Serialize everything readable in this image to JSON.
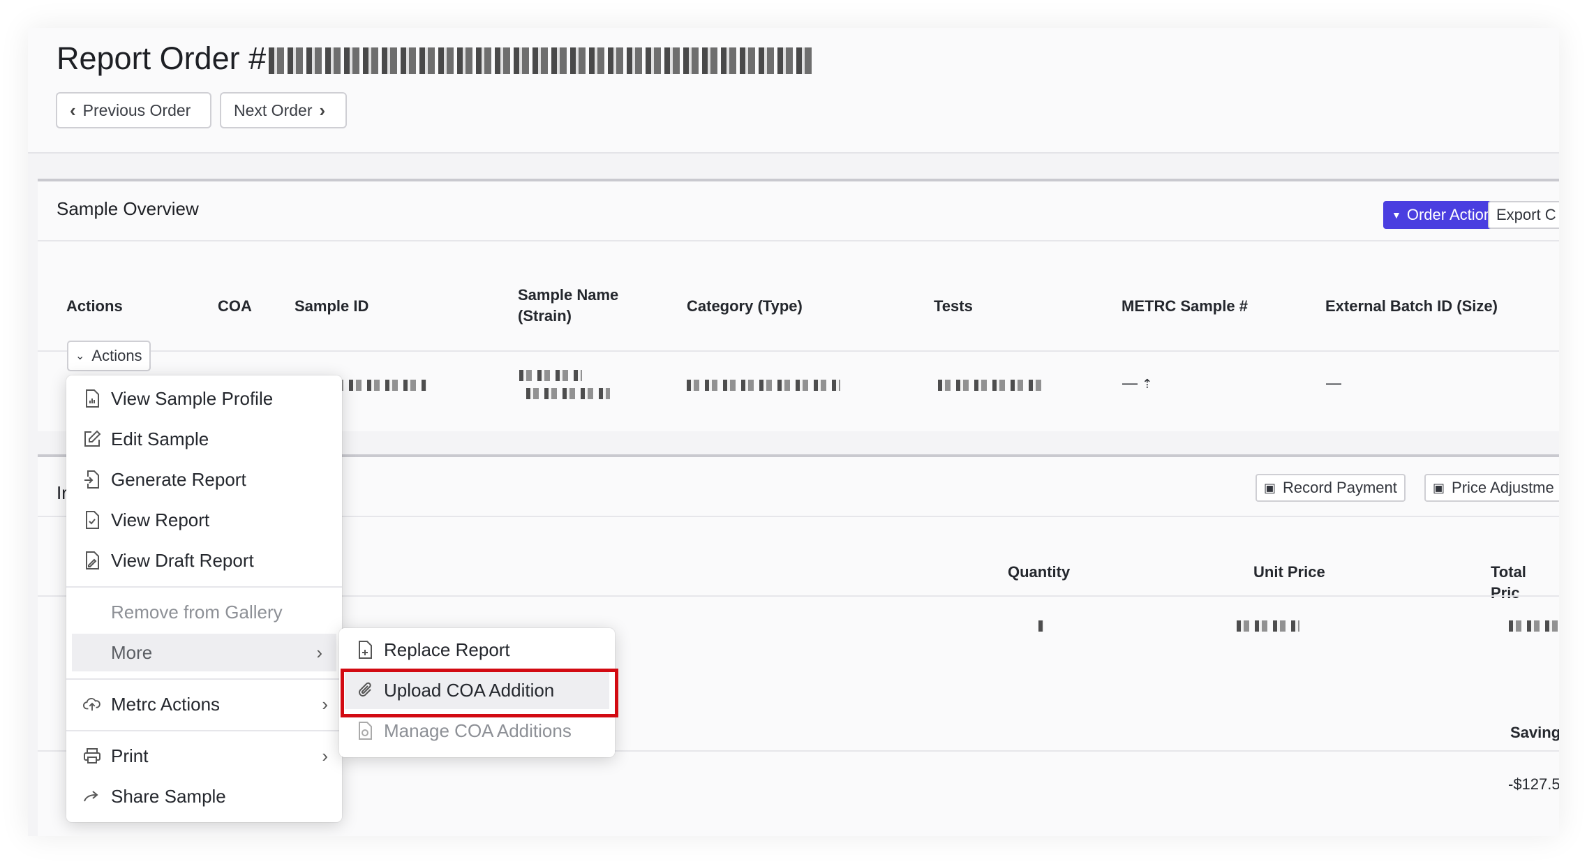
{
  "header": {
    "title_prefix": "Report Order #",
    "previous_label": "Previous Order",
    "next_label": "Next Order"
  },
  "sample_overview": {
    "title": "Sample Overview",
    "order_actions_label": "Order Actions",
    "export_label": "Export C",
    "columns": [
      "Actions",
      "COA",
      "Sample ID",
      "Sample Name (Strain)",
      "Category (Type)",
      "Tests",
      "METRC Sample #",
      "External Batch ID (Size)"
    ],
    "row": {
      "actions_label": "Actions",
      "metrc": "—",
      "external_batch": "—"
    }
  },
  "invoice": {
    "title_fragment": "Ir",
    "record_payment_label": "Record Payment",
    "price_adjustment_label": "Price Adjustme",
    "columns": [
      "Quantity",
      "Unit Price",
      "Total Pric"
    ],
    "savings_label": "Saving",
    "savings_value": "-$127.5"
  },
  "actions_menu": {
    "items": [
      {
        "label": "View Sample Profile",
        "icon": "file-chart-icon"
      },
      {
        "label": "Edit Sample",
        "icon": "edit-icon"
      },
      {
        "label": "Generate Report",
        "icon": "file-import-icon"
      },
      {
        "label": "View Report",
        "icon": "file-check-icon"
      },
      {
        "label": "View Draft Report",
        "icon": "file-draft-icon"
      },
      {
        "label": "Remove from Gallery",
        "icon": ""
      },
      {
        "label": "More",
        "icon": ""
      },
      {
        "label": "Metrc Actions",
        "icon": "cloud-upload-icon"
      },
      {
        "label": "Print",
        "icon": "printer-icon"
      },
      {
        "label": "Share Sample",
        "icon": "share-icon"
      }
    ]
  },
  "more_submenu": {
    "items": [
      {
        "label": "Replace Report",
        "icon": "file-replace-icon"
      },
      {
        "label": "Upload COA Addition",
        "icon": "paperclip-icon"
      },
      {
        "label": "Manage COA Additions",
        "icon": "file-manage-icon"
      }
    ]
  },
  "colors": {
    "primary": "#4a3ee0",
    "highlight": "#d20a12"
  }
}
